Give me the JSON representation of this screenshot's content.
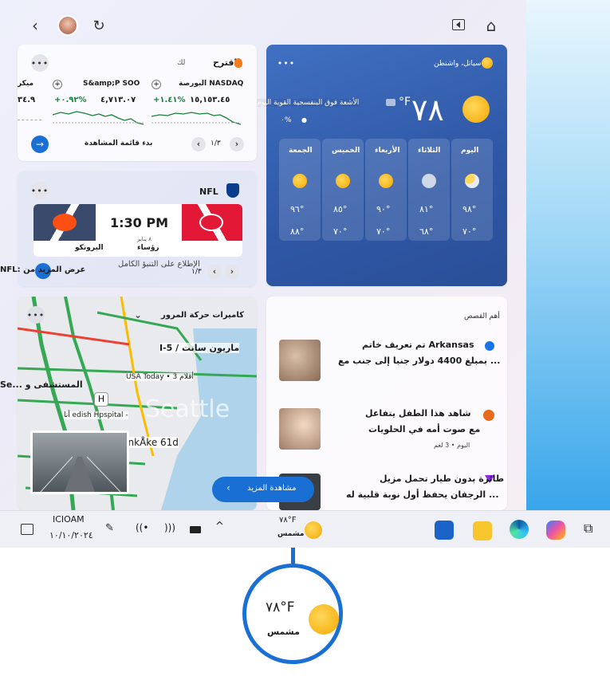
{
  "nav": {
    "back": "‹",
    "refresh": "↻",
    "home": "⌂"
  },
  "stocks": {
    "title": "اقترح",
    "subtitle": "لك",
    "items": [
      {
        "name": "ميكر",
        "value": "٣٤.٩",
        "change": ""
      },
      {
        "name": "S&amp;P SOO",
        "value": "٤,٧١٣.٠٧",
        "change": "+٠.٩٢%"
      },
      {
        "name": "البورصة NASDAQ",
        "value": "١٥,١٥٣.٤٥",
        "change": "+١.٤١%"
      }
    ],
    "pager": "١/٣",
    "watchlist": "بدء قائمة المشاهدة"
  },
  "nfl": {
    "title": "NFL",
    "time": "1:30 PM",
    "day": "رؤساء",
    "date": "٨ يناير",
    "team": "البرونكو",
    "link": "الإطلاع على التنبؤ الكامل",
    "pager": "١/٣",
    "more": "NFL: عرض المزيد من"
  },
  "weather": {
    "condition": "مشمس",
    "location": "سياتل، واشنطن",
    "temp": "٧٨",
    "unit": "°F",
    "uv": "الأشعة فوق البنفسجية القوية اليوم",
    "rain": "٠%",
    "days": [
      {
        "name": "اليوم",
        "high": "٩٨°",
        "low": "٧٠°",
        "icon": "partly-cloudy"
      },
      {
        "name": "الثلاثاء",
        "high": "٨١°",
        "low": "٦٨°",
        "icon": "rain"
      },
      {
        "name": "الأربعاء",
        "high": "٩٠°",
        "low": "٧٠°",
        "icon": "sunny"
      },
      {
        "name": "الخميس",
        "high": "٨٥°",
        "low": "٧٠°",
        "icon": "sunny"
      },
      {
        "name": "الجمعة",
        "high": "٩٦°",
        "low": "٨٨°",
        "icon": "sunny"
      }
    ]
  },
  "traffic": {
    "title": "كاميرات حركة المرور",
    "road": "I-5 / ماريون سانت",
    "label1": "USA Today • 3 أقلام",
    "label2": "Se... المستشفى و",
    "label3": "أنا edish Hpspital -",
    "label4": "KlonkÅke 61d",
    "map_text": "Seattle"
  },
  "news": {
    "header": "أهم القصص",
    "see_more": "مشاهدة المزيد",
    "items": [
      {
        "title": "تم تعريف خاتم Arkansas",
        "title2": "بمبلغ 4400 دولار جنبا إلى جنب مع ...",
        "meta": ""
      },
      {
        "title": "شاهد هذا الطفل يتفاعل",
        "title2": "مع صوت أمه في الحلويات",
        "meta": "اليوم • 3 لغم"
      },
      {
        "title": "طائرة بدون طيار تحمل مزيل",
        "title2": "الرجفان يحفظ أول نوبة قلبية له ...",
        "meta": ""
      }
    ]
  },
  "taskbar": {
    "time": "ICIOAM",
    "date": "١٠/١٠/٢٠٢٤",
    "temp": "٧٨°F",
    "condition": "مشمس"
  },
  "zoom": {
    "temp": "٧٨°F",
    "condition": "مشمس"
  },
  "colors": {
    "weather_bg": "#2f58a8",
    "accent": "#1a6fd4",
    "positive": "#188038"
  }
}
